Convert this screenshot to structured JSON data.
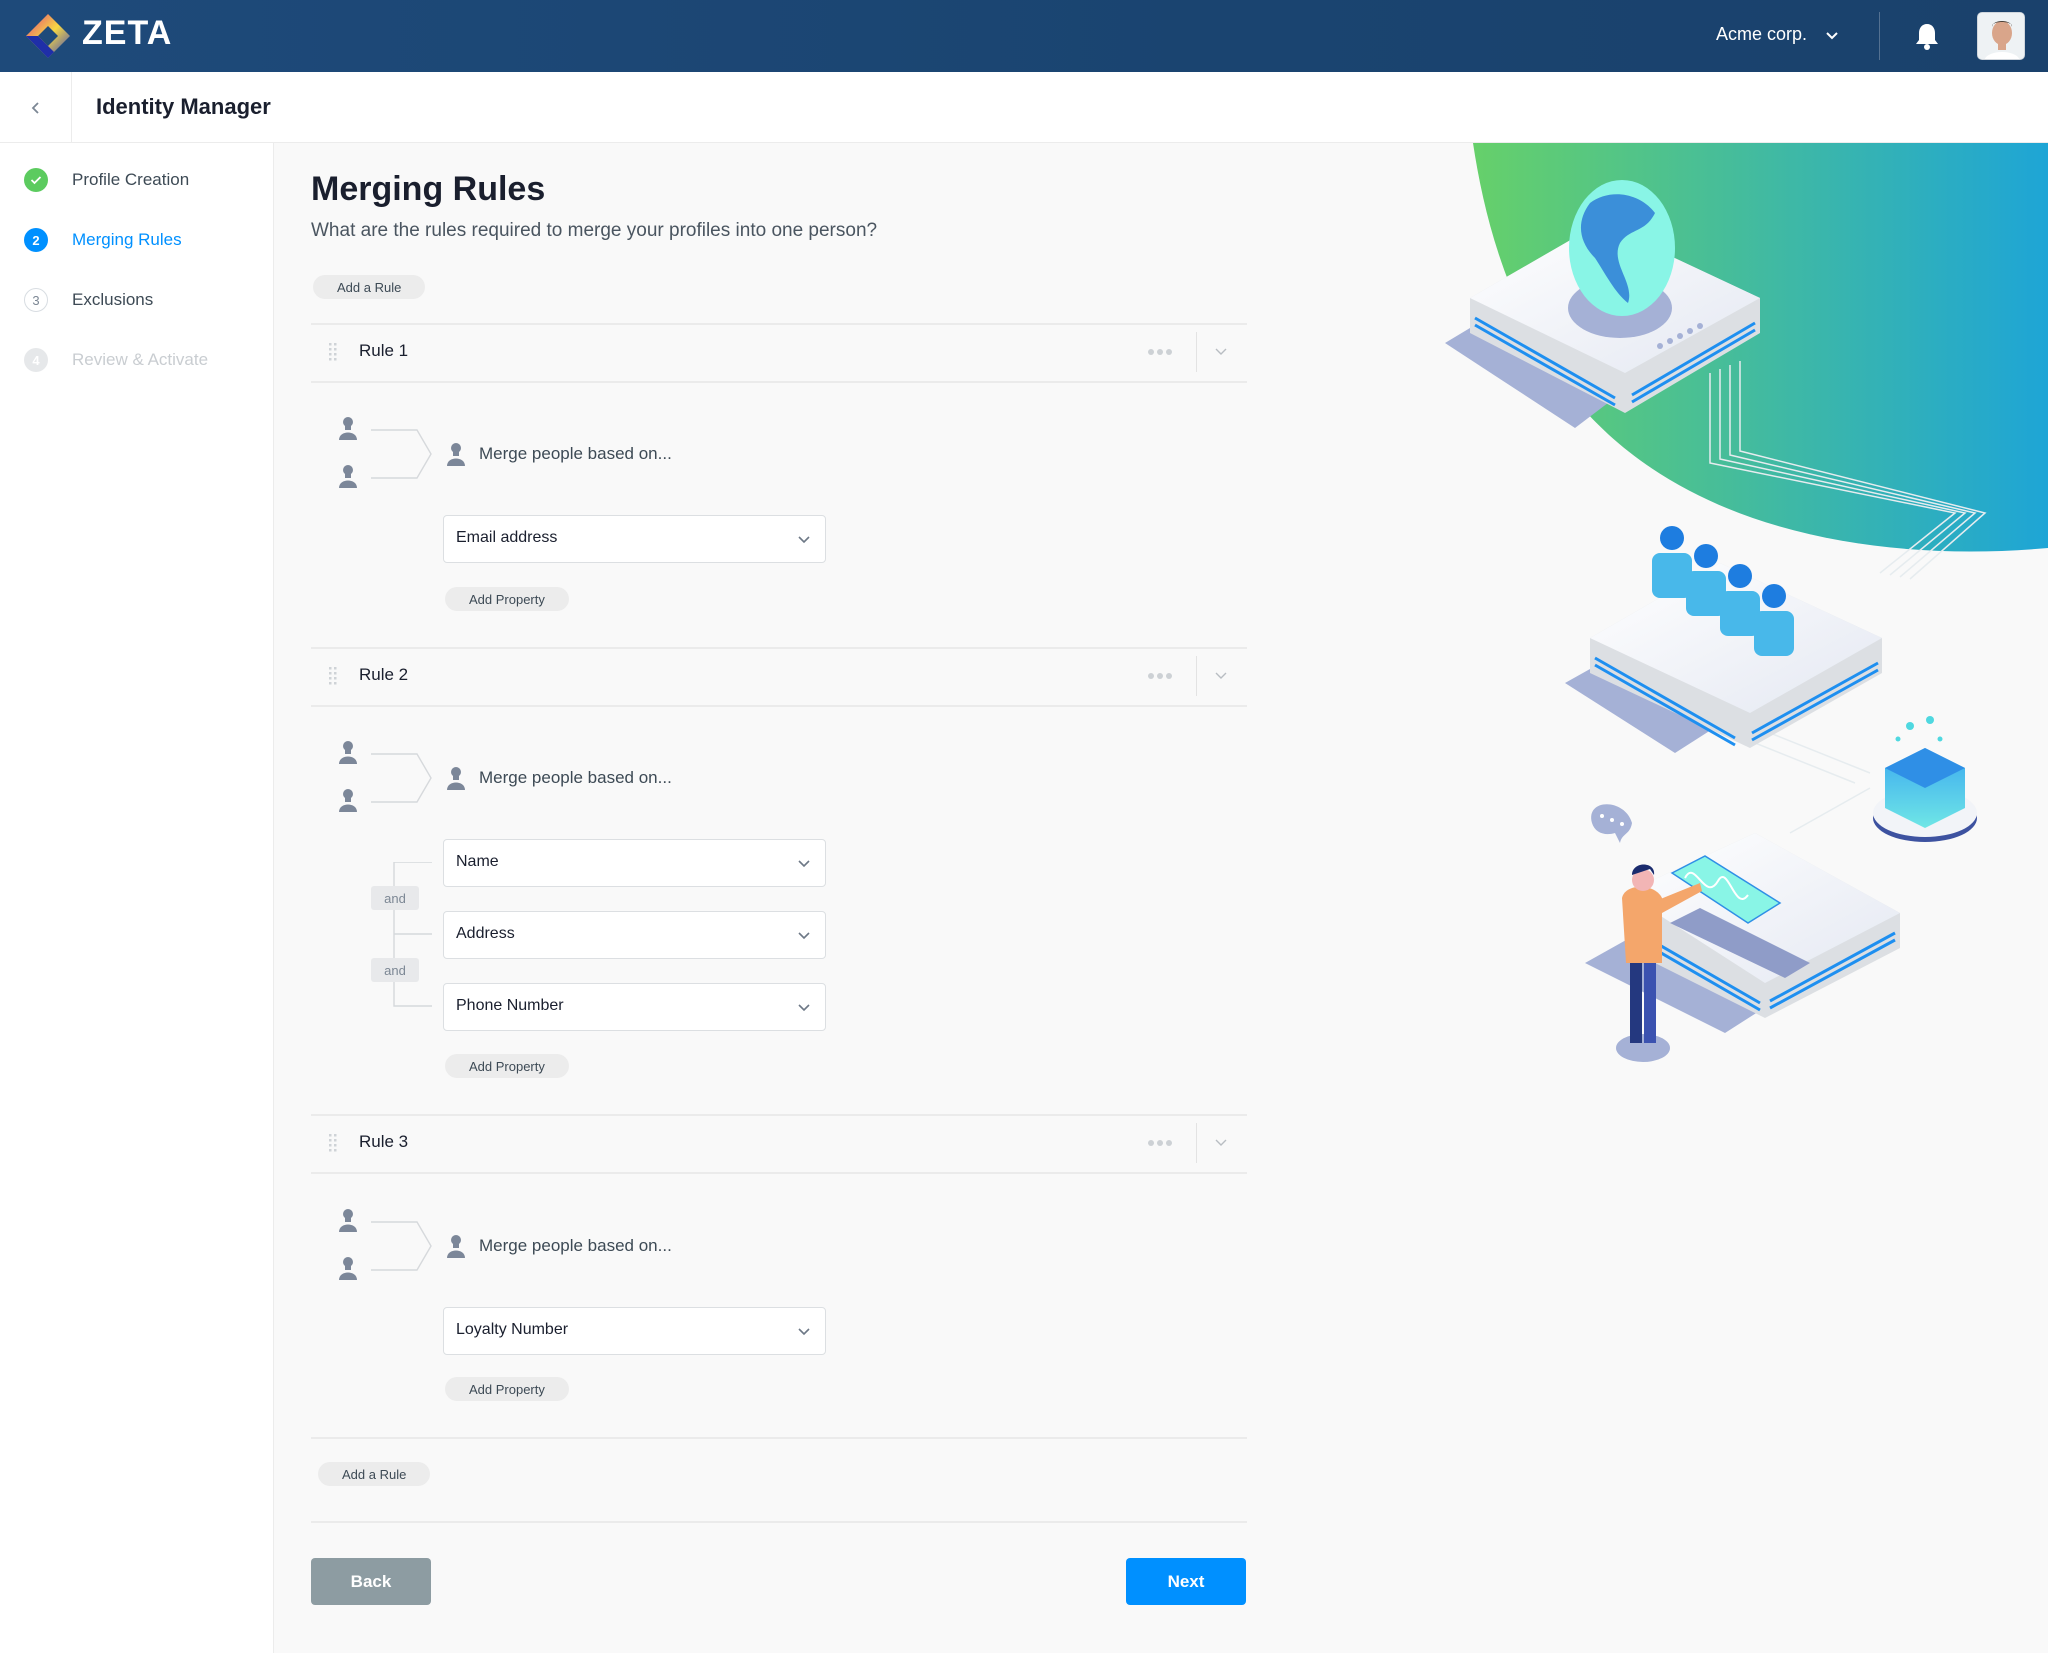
{
  "app": {
    "brand": "ZETA",
    "org_selector": "Acme corp.",
    "page_title": "Identity Manager"
  },
  "sidebar": {
    "steps": [
      {
        "number": "",
        "label": "Profile Creation",
        "state": "done"
      },
      {
        "number": "2",
        "label": "Merging Rules",
        "state": "active"
      },
      {
        "number": "3",
        "label": "Exclusions",
        "state": "todo"
      },
      {
        "number": "4",
        "label": "Review & Activate",
        "state": "disabled"
      }
    ]
  },
  "main": {
    "title": "Merging Rules",
    "subtitle": "What are the rules required to merge your profiles into one person?",
    "add_rule_label": "Add a Rule",
    "merge_prompt": "Merge people based on...",
    "add_property_label": "Add Property",
    "and_label": "and",
    "rules": [
      {
        "title": "Rule 1",
        "properties": [
          "Email address"
        ]
      },
      {
        "title": "Rule 2",
        "properties": [
          "Name",
          "Address",
          "Phone Number"
        ]
      },
      {
        "title": "Rule 3",
        "properties": [
          "Loyalty Number"
        ]
      }
    ],
    "back_label": "Back",
    "next_label": "Next"
  },
  "colors": {
    "header": "#1e4a7a",
    "accent": "#0090ff",
    "success": "#5ccb5f",
    "back_button": "#8d9ca2"
  }
}
